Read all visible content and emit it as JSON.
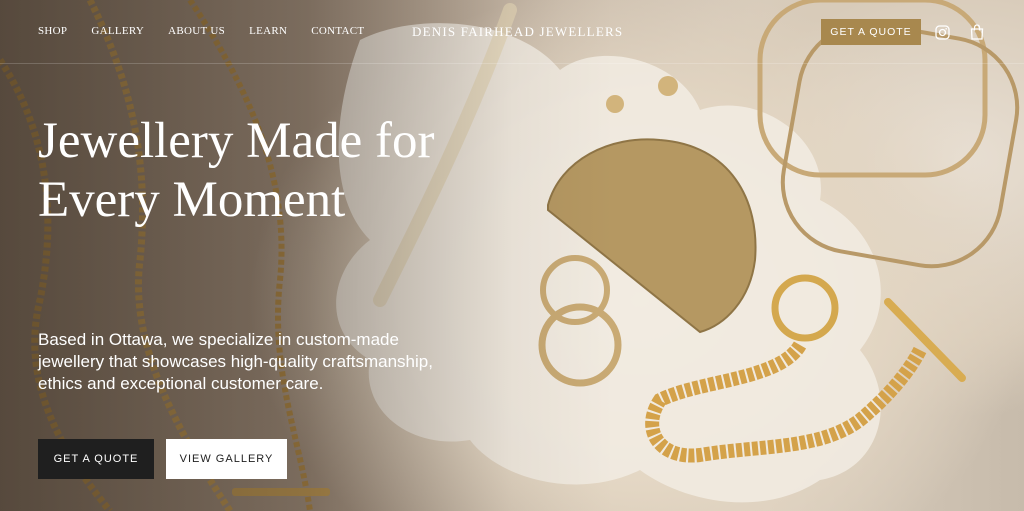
{
  "header": {
    "nav": [
      "SHOP",
      "GALLERY",
      "ABOUT US",
      "LEARN",
      "CONTACT"
    ],
    "brand": "DENIS FAIRHEAD JEWELLERS",
    "quote_label": "GET A QUOTE",
    "icons": [
      "instagram-icon",
      "shopping-bag-icon"
    ]
  },
  "hero": {
    "headline": "Jewellery Made for Every Moment",
    "subtext": "Based in Ottawa, we specialize in custom-made jewellery that showcases high-quality craftsmanship, ethics and exceptional customer care.",
    "primary_button": "GET A QUOTE",
    "secondary_button": "VIEW GALLERY"
  },
  "colors": {
    "accent": "#a8884e",
    "dark_button": "#1f1f1f",
    "text": "#ffffff"
  }
}
